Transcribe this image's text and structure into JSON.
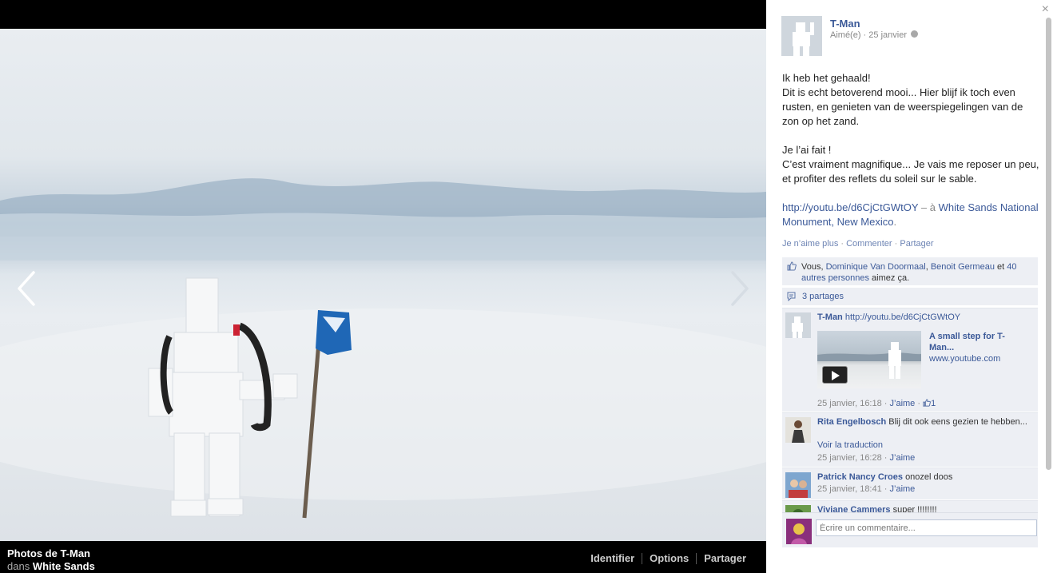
{
  "album": {
    "title": "Photos de T-Man",
    "place_prefix": "dans",
    "place": "White Sands"
  },
  "photo_actions": [
    "Identifier",
    "Options",
    "Partager"
  ],
  "post": {
    "author": "T-Man",
    "meta": "Aimé(e) · 25 janvier",
    "paragraph_nl": "Ik heb het gehaald!\nDit is echt betoverend mooi... Hier blijf ik toch even rusten, en genieten van de weerspiegelingen van de zon op het zand.",
    "paragraph_fr": "Je l’ai fait !\nC’est vraiment magnifique... Je vais me reposer un peu, et profiter des reflets du soleil sur le sable.",
    "link_url": "http://youtu.be/d6CjCtGWtOY",
    "link_sep": " – à ",
    "location": "White Sands National Monument, New Mexico",
    "location_end": ".",
    "actions": {
      "unlike": "Je n’aime plus",
      "comment": "Commenter",
      "share": "Partager",
      "sep": " · "
    }
  },
  "likes": {
    "prefix": "Vous, ",
    "person1": "Dominique Van Doormaal",
    "sep": ", ",
    "person2": "Benoit Germeau",
    "and": " et ",
    "others": "40 autres personnes",
    "suffix": " aimez ça."
  },
  "shares": {
    "label": "3 partages"
  },
  "comments": [
    {
      "name": "T-Man",
      "text": "http://youtu.be/d6CjCtGWtOY",
      "video_title": "A small step for T-Man...",
      "video_source": "www.youtube.com",
      "date": "25 janvier, 16:18",
      "like": "J’aime",
      "like_count": "1"
    },
    {
      "name": "Rita Engelbosch",
      "text": "Blij dit ook eens gezien te hebben...",
      "translate": "Voir la traduction",
      "date": "25 janvier, 16:28",
      "like": "J’aime"
    },
    {
      "name": "Patrick Nancy Croes",
      "text": "onozel doos",
      "date": "25 janvier, 18:41",
      "like": "J’aime"
    },
    {
      "name": "Viviane Cammers",
      "text": "super !!!!!!!!"
    }
  ],
  "compose": {
    "placeholder": "Écrire un commentaire..."
  },
  "close_glyph": "×",
  "icons": [
    "chevron-left-icon",
    "chevron-right-icon",
    "close-icon",
    "globe-icon",
    "thumbs-up-icon",
    "share-icon",
    "play-icon"
  ]
}
